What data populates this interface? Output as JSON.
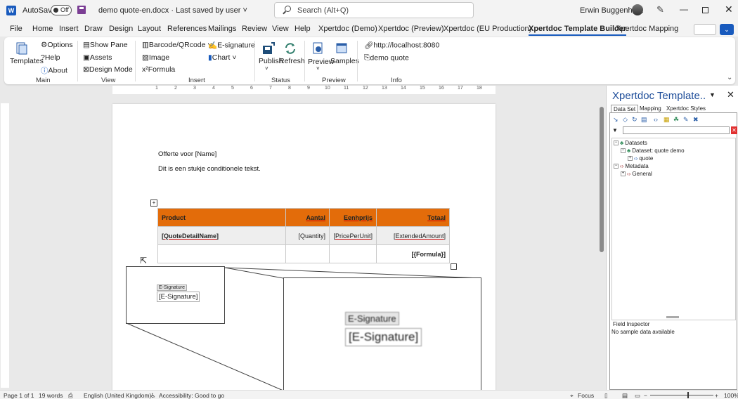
{
  "titlebar": {
    "autosave_label": "AutoSave",
    "autosave_state": "Off",
    "document": "demo quote-en.docx  ·  Last saved by user  ˅",
    "search_placeholder": "Search (Alt+Q)",
    "user_name": "Erwin Buggenhout"
  },
  "tabs": [
    "File",
    "Home",
    "Insert",
    "Draw",
    "Design",
    "Layout",
    "References",
    "Mailings",
    "Review",
    "View",
    "Help",
    "Xpertdoc (Demo)",
    "Xpertdoc (Preview)",
    "Xpertdoc (EU Production)",
    "Xpertdoc Template Builder",
    "Xpertdoc Mapping"
  ],
  "active_tab": "Xpertdoc Template Builder",
  "ribbon": {
    "templates": "Templates",
    "options": "Options",
    "help": "Help",
    "about": "About",
    "show_pane": "Show Pane",
    "assets": "Assets",
    "design_mode": "Design Mode",
    "barcode": "Barcode/QRcode ˅",
    "image": "Image",
    "formula": "Formula",
    "esignature": "E-signature",
    "chart": "Chart ˅",
    "publish": "Publish",
    "refresh": "Refresh",
    "preview": "Preview",
    "samples": "Samples",
    "url": "http://localhost:8080",
    "dataset": "demo quote",
    "groups": {
      "main": "Main",
      "view": "View",
      "insert": "Insert",
      "status": "Status",
      "preview": "Preview",
      "info": "Info"
    }
  },
  "ruler_numbers": [
    "1",
    "2",
    "3",
    "4",
    "5",
    "6",
    "7",
    "8",
    "9",
    "10",
    "11",
    "12",
    "13",
    "14",
    "15",
    "16",
    "17",
    "18"
  ],
  "document": {
    "line1": "Offerte voor [Name]",
    "line2": "Dit is een stukje conditionele tekst.",
    "table": {
      "headers": [
        "Product",
        "Aantal",
        "Eenhprijs",
        "Totaal"
      ],
      "row1": [
        "[QuoteDetailName]",
        "[Quantity]",
        "[PricePerUnit]",
        "[ExtendedAmount]"
      ],
      "row2": [
        "",
        "",
        "",
        "[{Formula}]"
      ]
    },
    "esig_tag": "E-Signature",
    "esig_field": "[E-Signature]"
  },
  "pane": {
    "title": "Xpertdoc Template..",
    "tabs": [
      "Data Set",
      "Mapping",
      "Xpertdoc Styles"
    ],
    "tree": {
      "datasets": "Datasets",
      "dataset_quote": "Dataset: quote demo",
      "quote": "quote",
      "metadata": "Metadata",
      "general": "General"
    },
    "field_inspector": "Field Inspector",
    "no_sample": "No sample data available"
  },
  "statusbar": {
    "page": "Page 1 of 1",
    "words": "19 words",
    "language": "English (United Kingdom)",
    "accessibility": "Accessibility: Good to go",
    "focus": "Focus",
    "zoom": "100%"
  },
  "colors": {
    "accent": "#185abd",
    "table_header": "#e36c0a",
    "pane_title": "#1f4e9a"
  }
}
